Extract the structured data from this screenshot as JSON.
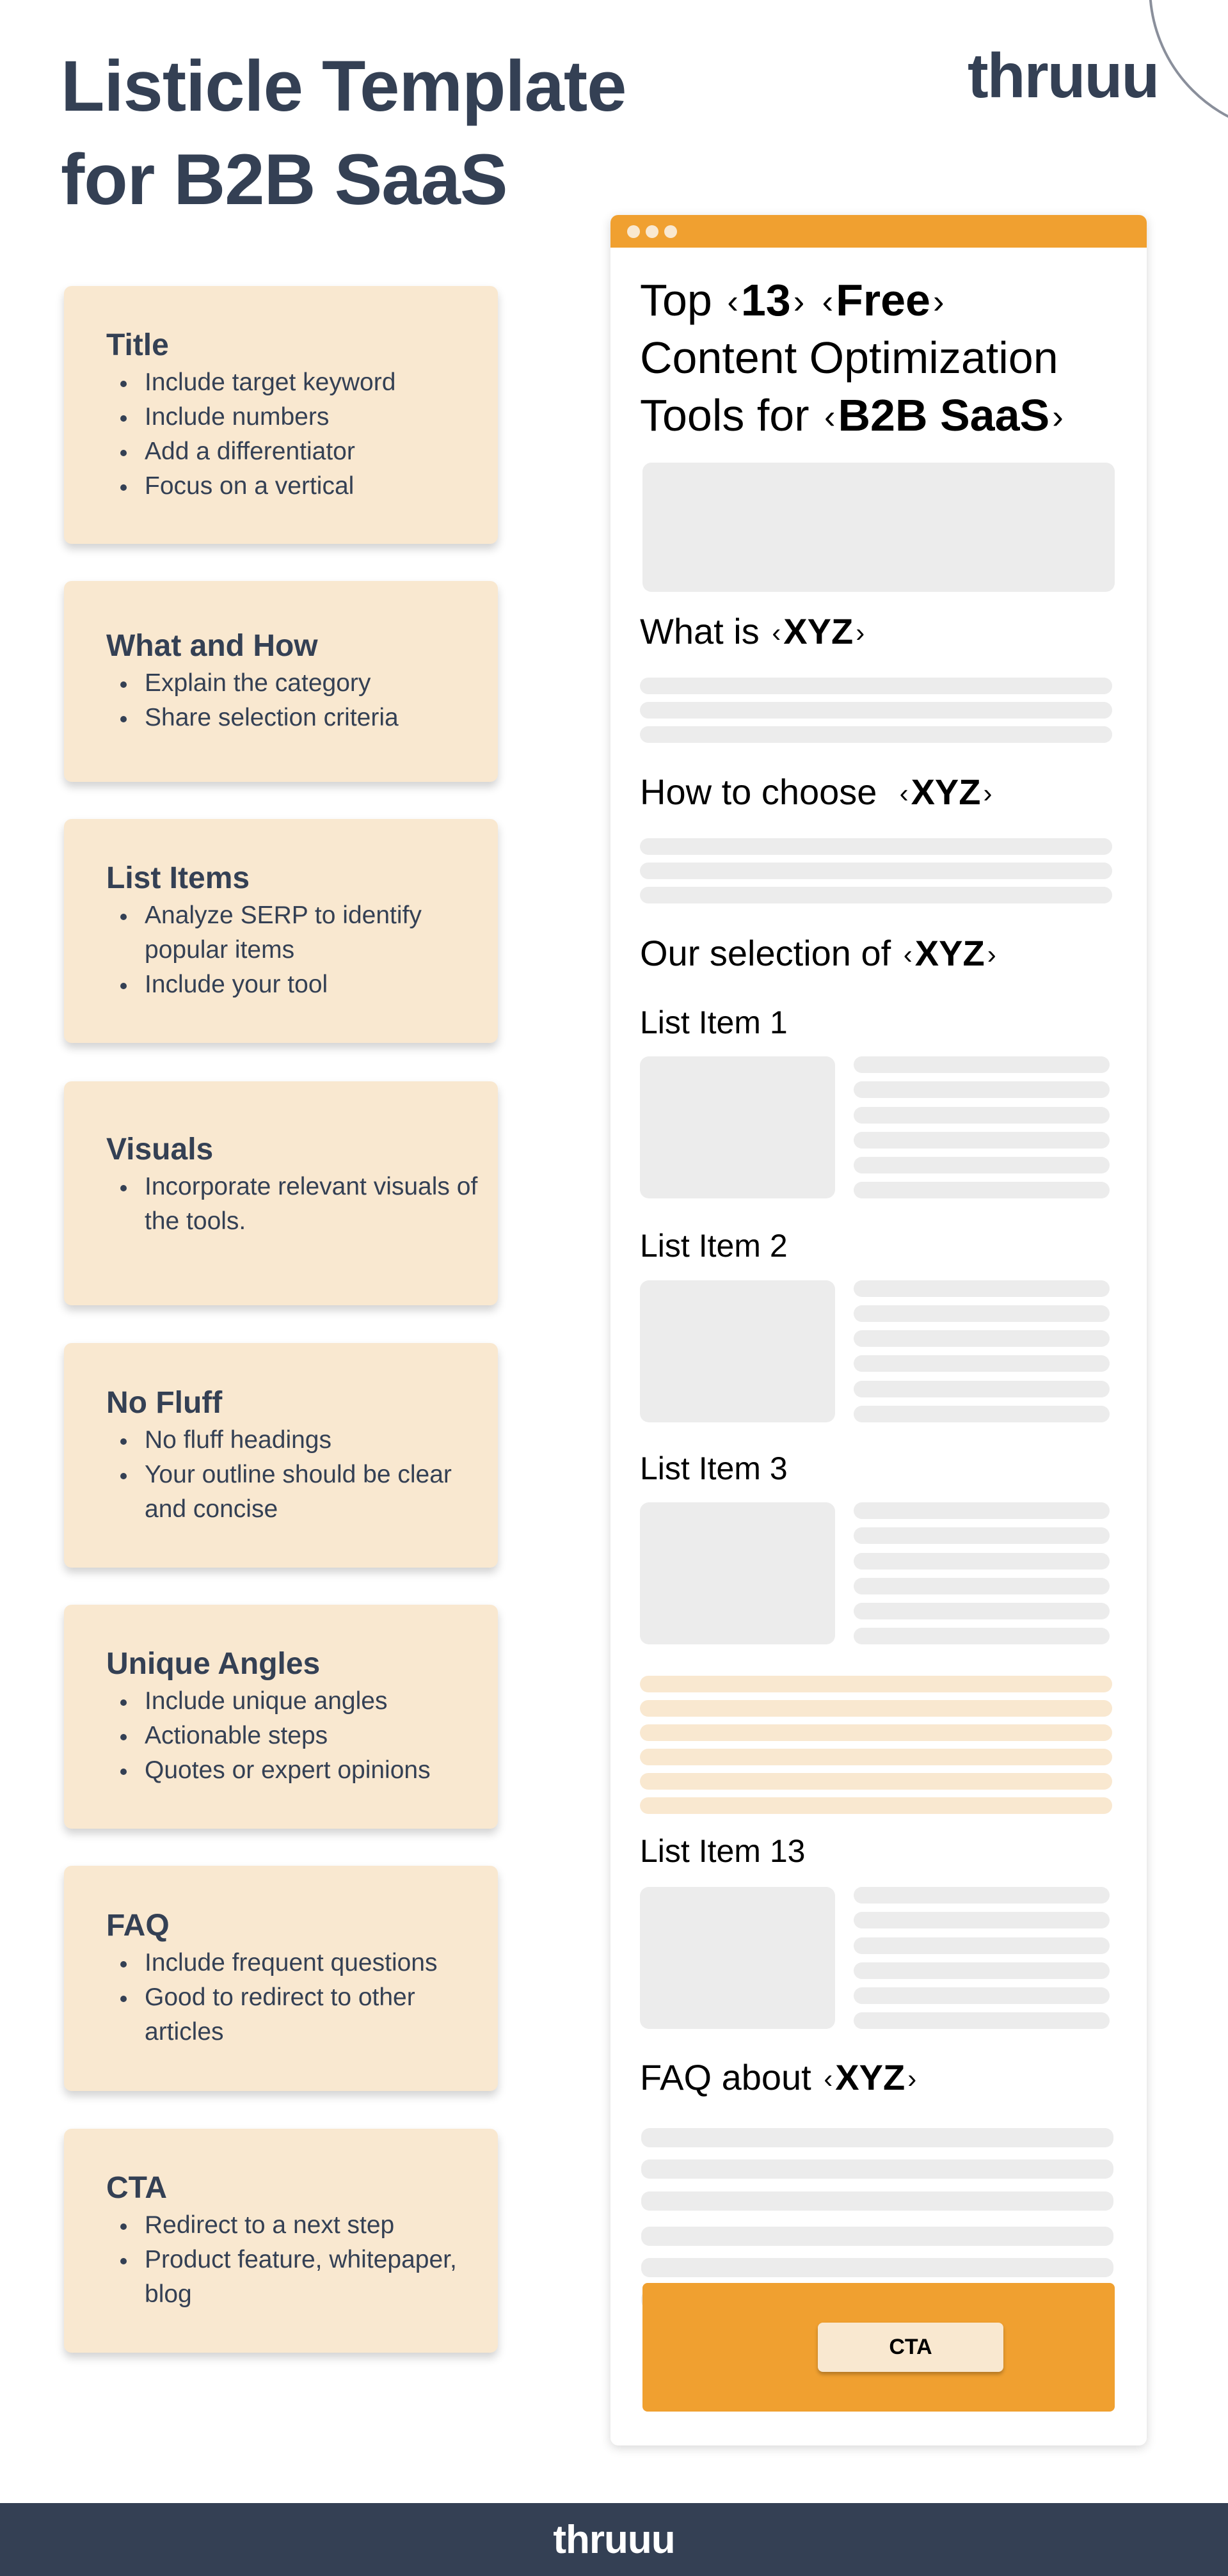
{
  "header": {
    "title_line1": "Listicle Template",
    "title_line2": "for B2B SaaS",
    "brand": "thruuu"
  },
  "colors": {
    "navy": "#344054",
    "card_bg": "#f9e8d0",
    "accent_orange": "#f0a030",
    "skeleton_gray": "#ececec"
  },
  "cards": [
    {
      "title": "Title",
      "bullets": [
        "Include target keyword",
        "Include numbers",
        "Add a differentiator",
        "Focus on a vertical"
      ]
    },
    {
      "title": "What and How",
      "bullets": [
        "Explain the category",
        "Share selection criteria"
      ]
    },
    {
      "title": "List Items",
      "bullets": [
        "Analyze SERP to identify popular items",
        "Include your tool"
      ]
    },
    {
      "title": "Visuals",
      "bullets": [
        "Incorporate relevant visuals of the tools."
      ]
    },
    {
      "title": "No Fluff",
      "bullets": [
        "No fluff headings",
        "Your outline should be clear and concise"
      ]
    },
    {
      "title": "Unique Angles",
      "bullets": [
        "Include unique angles",
        "Actionable steps",
        "Quotes or expert opinions"
      ]
    },
    {
      "title": "FAQ",
      "bullets": [
        "Include frequent questions",
        "Good to redirect to other articles"
      ]
    },
    {
      "title": "CTA",
      "bullets": [
        "Redirect to a next step",
        "Product feature, whitepaper, blog"
      ]
    }
  ],
  "mockup": {
    "title": {
      "prefix": "Top",
      "number": "13",
      "qualifier": "Free",
      "middle_line": "Content Optimization",
      "line3_prefix": "Tools for",
      "vertical": "B2B SaaS"
    },
    "angle_open": "‹",
    "angle_close": "›",
    "what_is": {
      "prefix": "What is",
      "keyword": "XYZ"
    },
    "how_to_choose": {
      "prefix": "How to choose",
      "keyword": "XYZ"
    },
    "our_selection": {
      "prefix": "Our selection of",
      "keyword": "XYZ"
    },
    "list_items": [
      {
        "label": "List Item 1"
      },
      {
        "label": "List Item 2"
      },
      {
        "label": "List Item 3"
      },
      {
        "label": "List Item 13"
      }
    ],
    "faq": {
      "prefix": "FAQ about",
      "keyword": "XYZ"
    },
    "cta_button": "CTA"
  },
  "footer": {
    "brand": "thruuu"
  }
}
